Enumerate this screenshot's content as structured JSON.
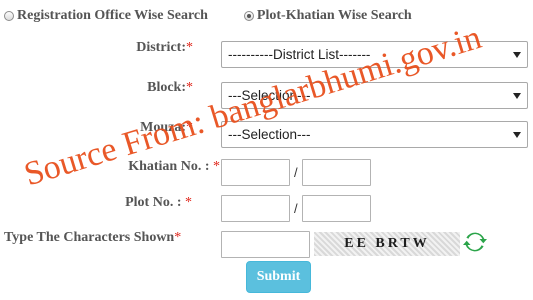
{
  "search_type": {
    "option1_label": "Registration Office Wise Search",
    "option2_label": "Plot-Khatian Wise Search",
    "selected": "Plot-Khatian Wise Search"
  },
  "form": {
    "district_label": "District:",
    "district_value": "----------District List-------",
    "block_label": "Block:",
    "block_value": "---Selection---",
    "mouza_label": "Mouza:",
    "mouza_value": "---Selection---",
    "khatian_label": "Khatian No. :",
    "plot_label": "Plot No. :",
    "captcha_label": "Type The Characters Shown",
    "required_mark": "*",
    "separator": "/",
    "captcha_text": "EE BRTW",
    "submit_label": "Submit"
  },
  "watermark": "Source From: banglarbhumi.gov.in",
  "colors": {
    "required": "#e0261b",
    "submit_bg": "#5bc0de",
    "watermark": "#e8501d",
    "refresh_icon": "#2ba44a"
  }
}
